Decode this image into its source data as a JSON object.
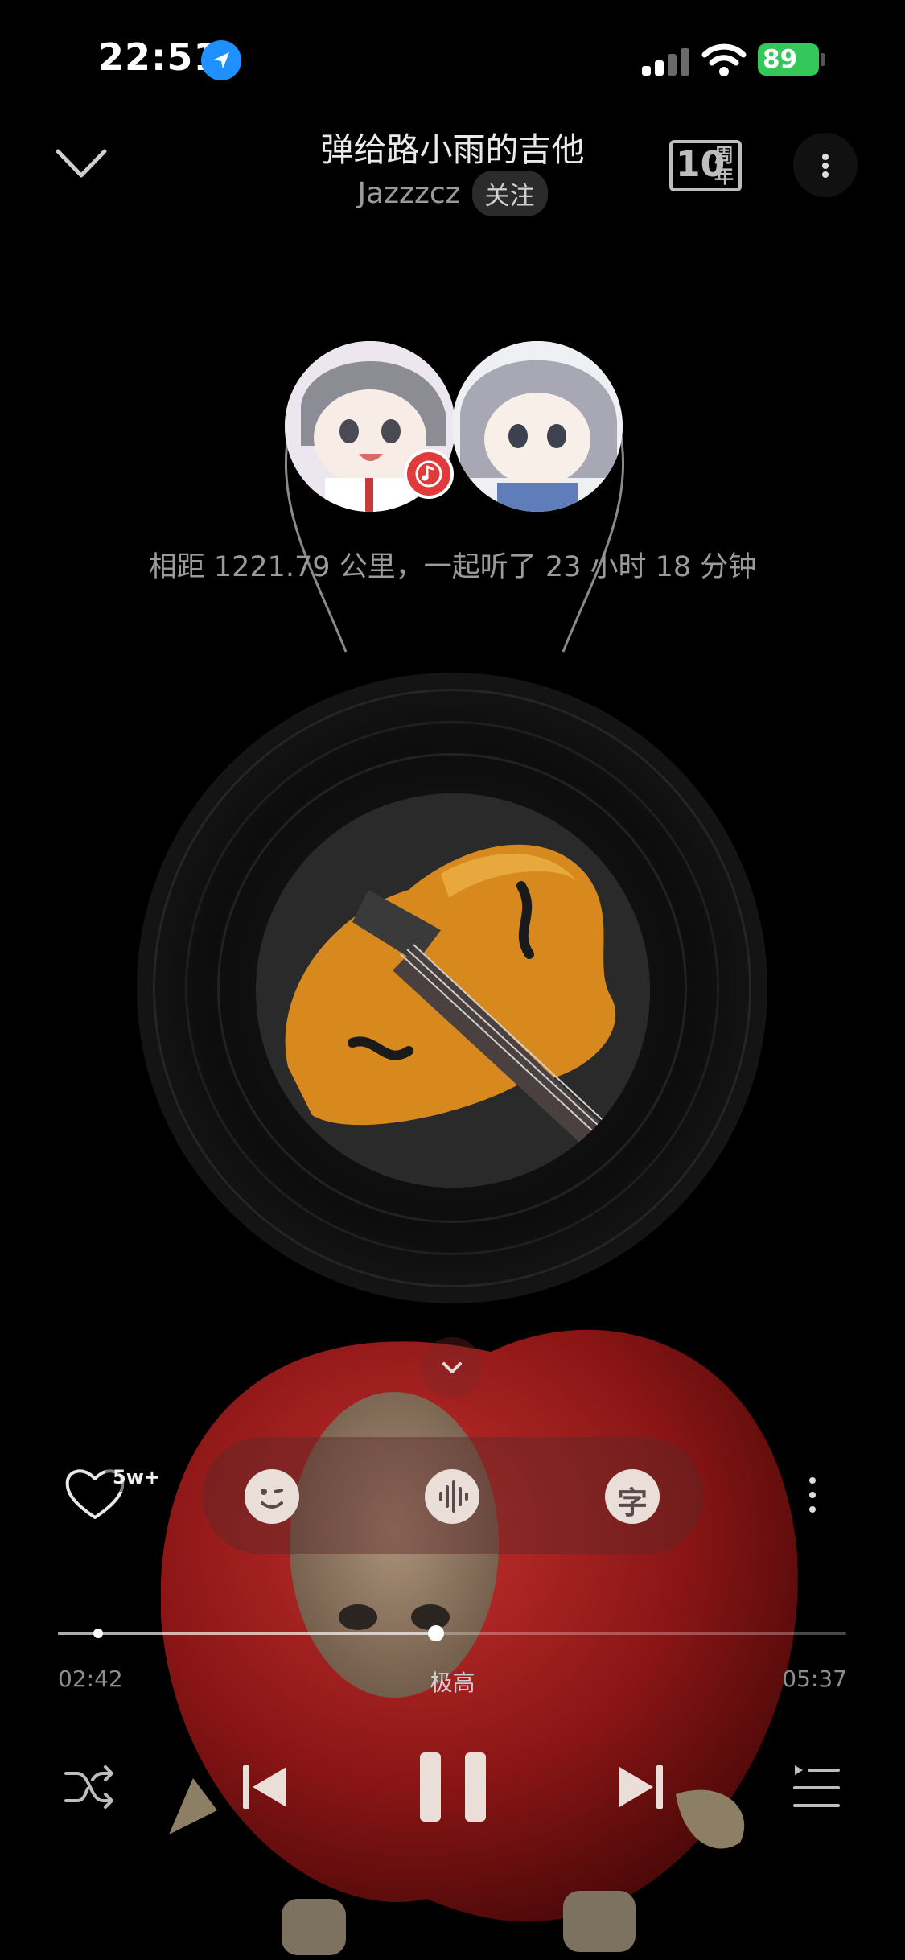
{
  "status_bar": {
    "time": "22:51",
    "battery": "89",
    "location_icon": "location-arrow-icon",
    "signal_icon": "cellular-signal-icon",
    "wifi_icon": "wifi-icon"
  },
  "header": {
    "title": "弹给路小雨的吉他",
    "artist": "Jazzzcz",
    "follow_label": "关注",
    "anniversary_badge": {
      "number": "10",
      "text": "周年"
    }
  },
  "listen_together": {
    "summary": "相距 1221.79 公里，一起听了 23 小时 18 分钟"
  },
  "actions": {
    "like_count": "5w+",
    "icons": [
      "heart-icon",
      "mood-icon",
      "sound-wave-icon",
      "lyrics-icon",
      "more-icon"
    ],
    "lyric_char": "字"
  },
  "playback": {
    "current_time": "02:42",
    "total_time": "05:37",
    "quality": "极高",
    "progress": 0.48,
    "controls": [
      "shuffle-icon",
      "previous-icon",
      "pause-icon",
      "next-icon",
      "playlist-icon"
    ]
  },
  "colors": {
    "background": "#000000",
    "accent_red": "#e03a3a",
    "battery_green": "#34c759",
    "location_blue": "#1e90ff"
  }
}
